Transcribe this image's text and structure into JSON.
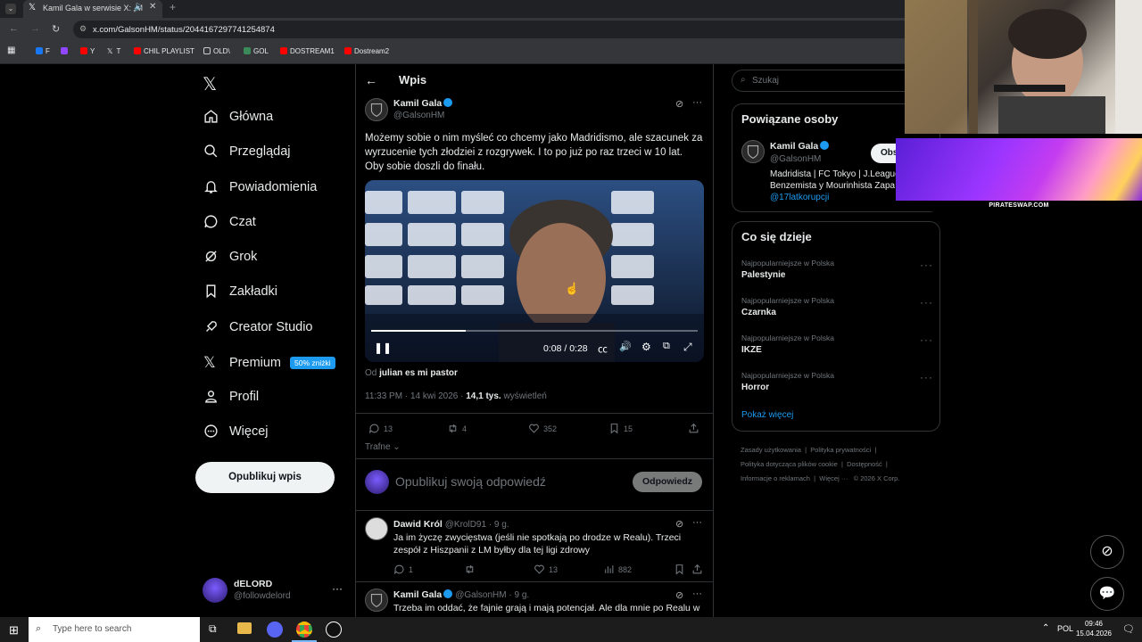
{
  "browser": {
    "tab_title": "Kamil Gala w serwisie X: „M",
    "url": "x.com/GalsonHM/status/2044167297741254874",
    "bookmarks": [
      "F",
      "Y",
      "T",
      "CHIL PLAYLIST",
      "OLD\\",
      "GOL",
      "DOSTREAM1",
      "Dostream2"
    ]
  },
  "nav": {
    "items": [
      "Główna",
      "Przeglądaj",
      "Powiadomienia",
      "Czat",
      "Grok",
      "Zakładki",
      "Creator Studio",
      "Premium",
      "Profil",
      "Więcej"
    ],
    "premium_badge": "50% zniżki",
    "post_button": "Opublikuj wpis",
    "user_name": "dELORD",
    "user_handle": "@followdelord"
  },
  "header": {
    "title": "Wpis"
  },
  "post": {
    "author": "Kamil Gala",
    "handle": "@GalsonHM",
    "text": "Możemy sobie o nim myśleć co chcemy jako Madridismo, ale szacunek za wyrzucenie tych złodziei z rozgrywek. I to po już po raz trzeci w 10 lat. Oby sobie doszli do finału.",
    "video_time": "0:08 / 0:28",
    "video_progress": 0.29,
    "from_prefix": "Od",
    "from_name": "julian es mi pastor",
    "timestamp": "11:33 PM · 14 kwi 2026 ·",
    "views_count": "14,1 tys.",
    "views_label": "wyświetleń",
    "replies": "13",
    "reposts": "4",
    "likes": "352",
    "bookmarks": "15",
    "sort": "Trafne"
  },
  "reply_box": {
    "placeholder": "Opublikuj swoją odpowiedź",
    "button": "Odpowiedz"
  },
  "replies": [
    {
      "name": "Dawid Król",
      "handle": "@KrolD91 · 9 g.",
      "text": "Ja im życzę zwycięstwa (jeśli nie spotkają po drodze w Realu). Trzeci zespół z Hiszpanii z LM byłby dla tej ligi zdrowy",
      "replies": "1",
      "likes": "13",
      "views": "882"
    },
    {
      "name": "Kamil Gala",
      "handle": "@GalsonHM · 9 g.",
      "text": "Trzeba im oddać, że fajnie grają i mają potencjał. Ale dla mnie po Realu w"
    }
  ],
  "search": {
    "placeholder": "Szukaj"
  },
  "related": {
    "title": "Powiązane osoby",
    "name": "Kamil Gala",
    "handle": "@GalsonHM",
    "follow": "Obs",
    "bio_line1": "Madridista | FC Tokyo | J.League",
    "bio_line2": "Benzemista y Mourinhista Zapa",
    "bio_link": "@17latkorupcji"
  },
  "trends": {
    "title": "Co się dzieje",
    "items": [
      {
        "category": "Najpopularniejsze w Polska",
        "name": "Palestynie"
      },
      {
        "category": "Najpopularniejsze w Polska",
        "name": "Czarnka"
      },
      {
        "category": "Najpopularniejsze w Polska",
        "name": "IKZE"
      },
      {
        "category": "Najpopularniejsze w Polska",
        "name": "Horror"
      }
    ],
    "more": "Pokaż więcej"
  },
  "footer": {
    "line1a": "Zasady użytkowania",
    "line1b": "Polityka prywatności",
    "line2a": "Polityka dotycząca plików cookie",
    "line2b": "Dostępność",
    "line3a": "Informacje o reklamach",
    "line3b": "Więcej ···",
    "line3c": "© 2026 X Corp."
  },
  "overlay": {
    "banner_text": "PIRATESWAP.COM"
  },
  "taskbar": {
    "search_placeholder": "Type here to search",
    "lang": "POL",
    "time": "09:46",
    "date": "15.04.2026"
  }
}
